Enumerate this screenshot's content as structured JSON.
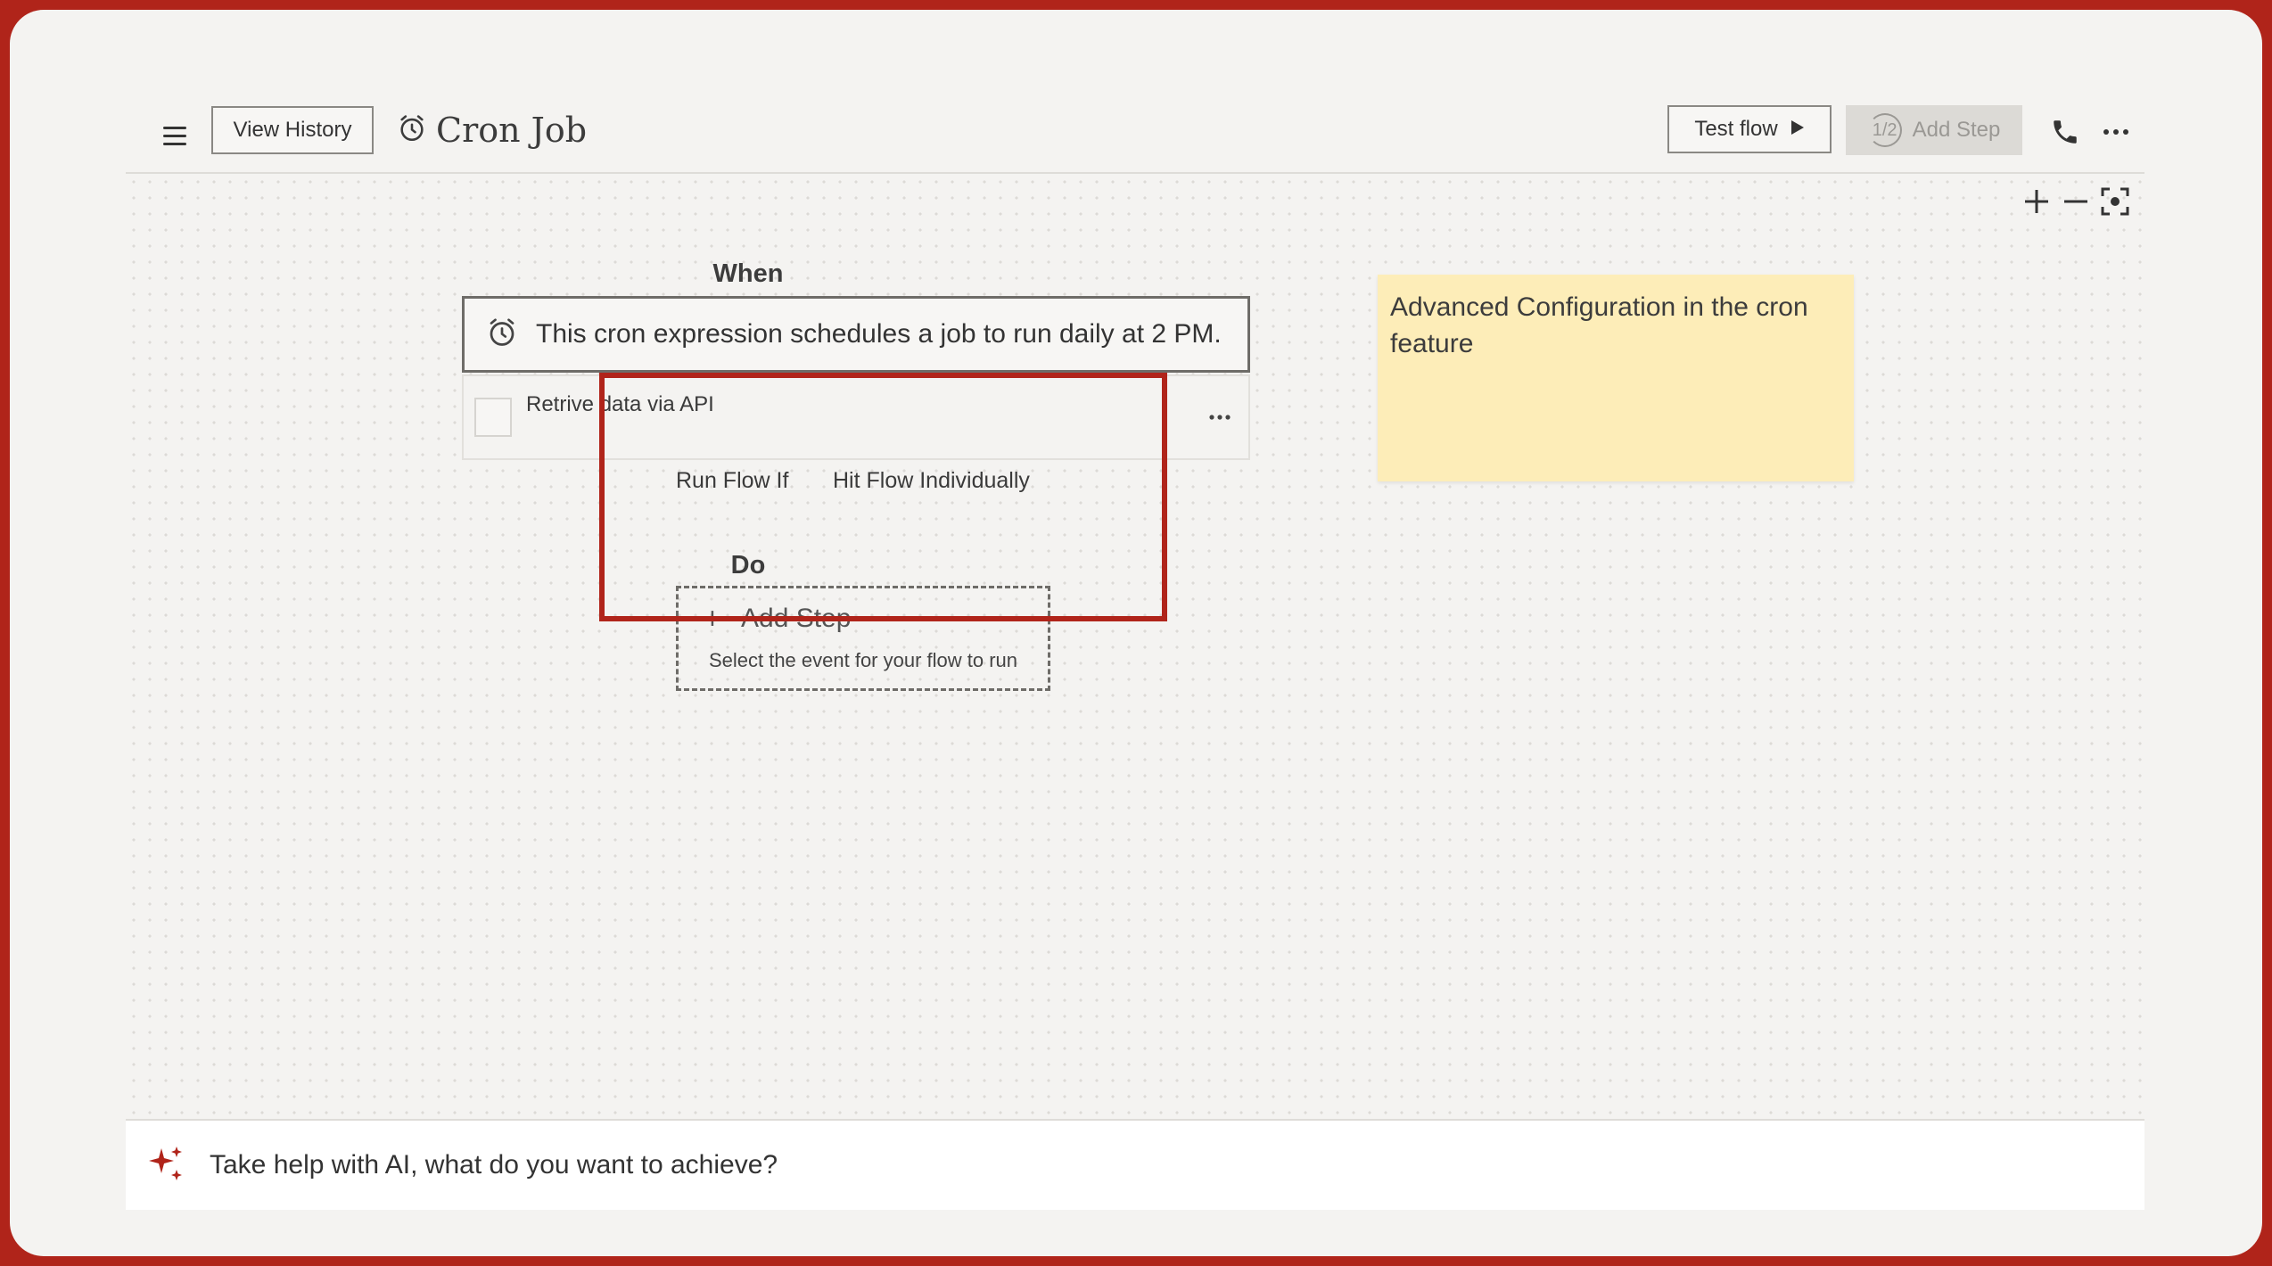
{
  "header": {
    "view_history_label": "View History",
    "title": "Cron Job",
    "test_flow_label": "Test flow",
    "add_step_badge": "1/2",
    "add_step_label": "Add Step"
  },
  "icons": {
    "menu": "hamburger-icon",
    "title_icon": "alarm-clock-icon",
    "test_flow_icon": "play-icon",
    "phone": "phone-icon",
    "more": "more-horizontal-icon",
    "zoom_in": "plus-icon",
    "zoom_out": "minus-icon",
    "fit": "focus-icon",
    "ai": "sparkles-icon"
  },
  "canvas": {
    "when_label": "When",
    "trigger_text": "This cron expression schedules a job to run daily at 2 PM.",
    "sub_step_label": "Retrive data via API",
    "run_flow_if": "Run Flow If",
    "hit_flow_individually": "Hit Flow Individually",
    "do_label": "Do",
    "add_step": {
      "plus": "+",
      "title": "Add Step",
      "description": "Select the event for your flow to run"
    },
    "sticky_note": "Advanced Configuration in the cron feature"
  },
  "ai_bar": {
    "placeholder": "Take help with AI, what do you want to achieve?"
  },
  "colors": {
    "accent_red": "#b0241a",
    "background": "#f4f3f1",
    "sticky_yellow": "#fdedb8"
  }
}
